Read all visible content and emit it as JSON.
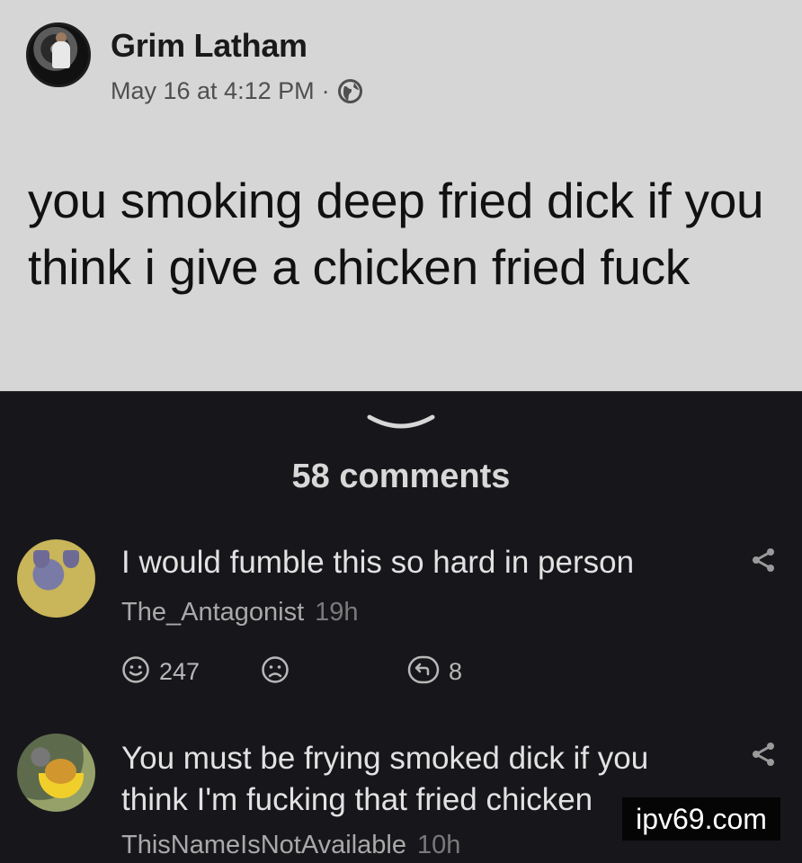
{
  "post": {
    "author": "Grim Latham",
    "timestamp": "May 16 at 4:12 PM",
    "separator": "·",
    "visibility_icon": "globe-icon",
    "text": "you smoking deep fried dick if you think i give a chicken fried fuck"
  },
  "comments_section": {
    "collapse_icon": "chevron-down-icon",
    "count_label": "58 comments"
  },
  "comments": [
    {
      "text": "I would fumble this so hard in person",
      "author": "The_Antagonist",
      "time": "19h",
      "upvotes": "247",
      "replies": "8"
    },
    {
      "text": "You must be frying smoked dick if you think I'm fucking that fried chicken",
      "author": "ThisNameIsNotAvailable",
      "time": "10h"
    }
  ],
  "watermark": "ipv69.com",
  "colors": {
    "post_background": "#d6d6d6",
    "comments_background": "#17171b",
    "text_light": "#e2e2e2"
  }
}
